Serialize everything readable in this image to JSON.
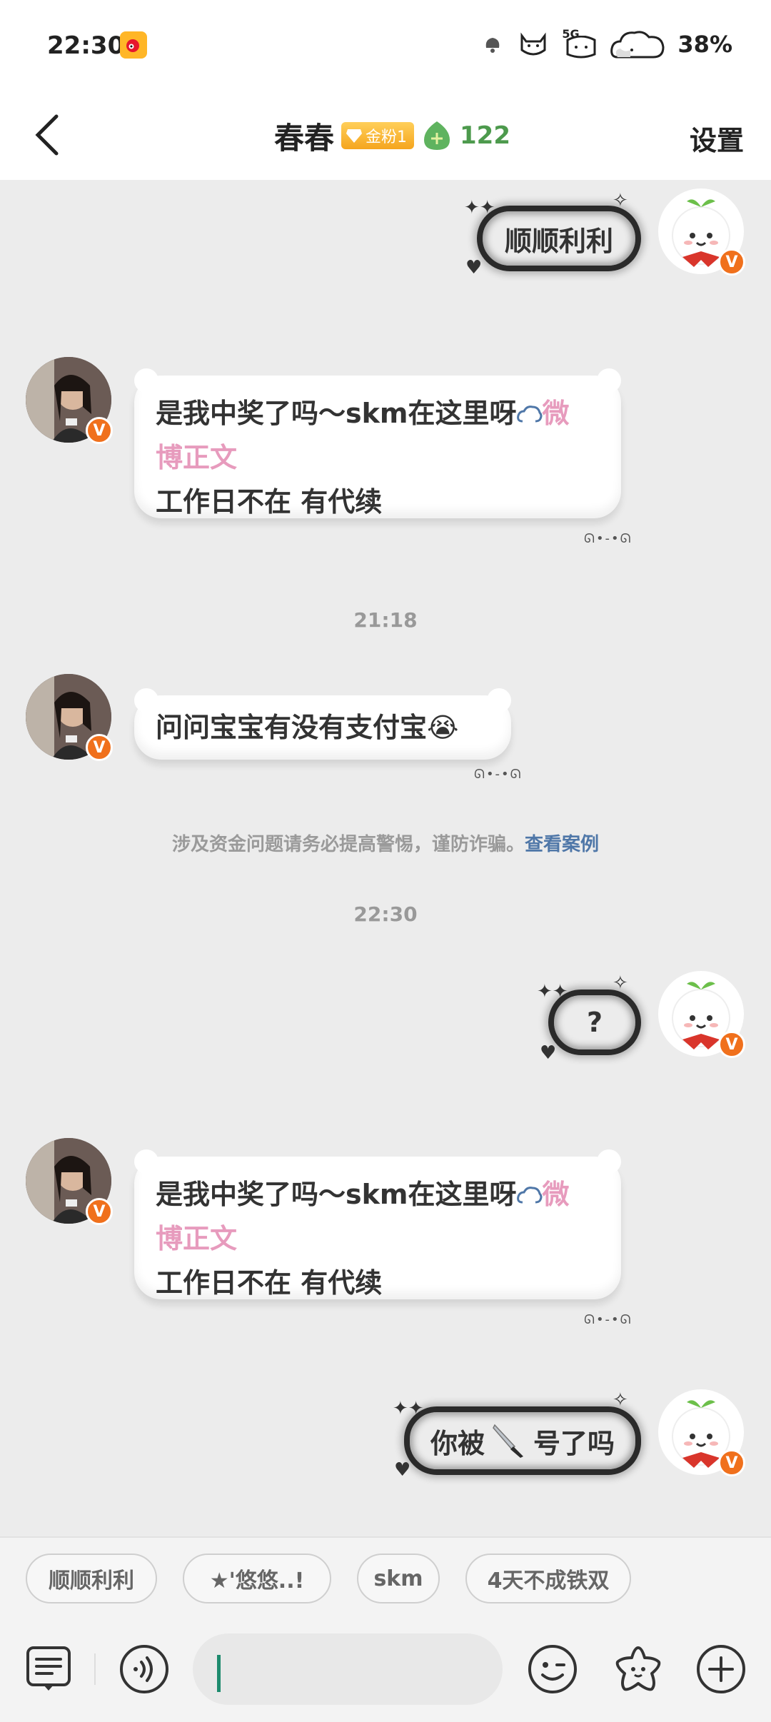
{
  "status_bar": {
    "time": "22:30",
    "network": "5G",
    "battery": "38%"
  },
  "header": {
    "name": "春春",
    "fan_badge": "金粉1",
    "fan_count": "122",
    "settings": "设置"
  },
  "messages": {
    "m1": "顺顺利利",
    "m2_line1": "是我中奖了吗～skm在这里呀",
    "m2_link": "微",
    "m2_link2": "博正文",
    "m2_line3": "工作日不在  有代续",
    "t1": "21:18",
    "m3": "问问宝宝有没有支付宝",
    "m3_emoji": "😭",
    "warning_text": "涉及资金问题请务必提高警惕，谨防诈骗。",
    "warning_link": "查看案例",
    "t2": "22:30",
    "m4": "?",
    "m5_line1": "是我中奖了吗～skm在这里呀",
    "m5_link": "微",
    "m5_link2": "博正文",
    "m5_line3": "工作日不在  有代续",
    "m6_a": "你被",
    "m6_b": "号了吗"
  },
  "quick_replies": [
    "顺顺利利",
    "★'悠悠..!",
    "skm",
    "4天不成铁双"
  ],
  "colors": {
    "accent_green": "#1e8b6e",
    "badge_orange": "#f0701c",
    "link_pink": "#e79bbd",
    "link_blue": "#4f77a8"
  }
}
